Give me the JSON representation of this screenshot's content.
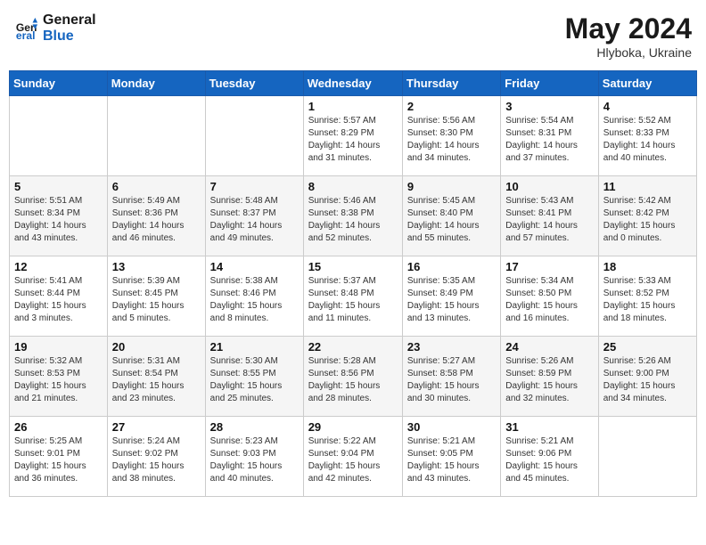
{
  "header": {
    "logo_line1": "General",
    "logo_line2": "Blue",
    "month_year": "May 2024",
    "location": "Hlyboka, Ukraine"
  },
  "weekdays": [
    "Sunday",
    "Monday",
    "Tuesday",
    "Wednesday",
    "Thursday",
    "Friday",
    "Saturday"
  ],
  "weeks": [
    [
      {
        "day": "",
        "info": ""
      },
      {
        "day": "",
        "info": ""
      },
      {
        "day": "",
        "info": ""
      },
      {
        "day": "1",
        "info": "Sunrise: 5:57 AM\nSunset: 8:29 PM\nDaylight: 14 hours\nand 31 minutes."
      },
      {
        "day": "2",
        "info": "Sunrise: 5:56 AM\nSunset: 8:30 PM\nDaylight: 14 hours\nand 34 minutes."
      },
      {
        "day": "3",
        "info": "Sunrise: 5:54 AM\nSunset: 8:31 PM\nDaylight: 14 hours\nand 37 minutes."
      },
      {
        "day": "4",
        "info": "Sunrise: 5:52 AM\nSunset: 8:33 PM\nDaylight: 14 hours\nand 40 minutes."
      }
    ],
    [
      {
        "day": "5",
        "info": "Sunrise: 5:51 AM\nSunset: 8:34 PM\nDaylight: 14 hours\nand 43 minutes."
      },
      {
        "day": "6",
        "info": "Sunrise: 5:49 AM\nSunset: 8:36 PM\nDaylight: 14 hours\nand 46 minutes."
      },
      {
        "day": "7",
        "info": "Sunrise: 5:48 AM\nSunset: 8:37 PM\nDaylight: 14 hours\nand 49 minutes."
      },
      {
        "day": "8",
        "info": "Sunrise: 5:46 AM\nSunset: 8:38 PM\nDaylight: 14 hours\nand 52 minutes."
      },
      {
        "day": "9",
        "info": "Sunrise: 5:45 AM\nSunset: 8:40 PM\nDaylight: 14 hours\nand 55 minutes."
      },
      {
        "day": "10",
        "info": "Sunrise: 5:43 AM\nSunset: 8:41 PM\nDaylight: 14 hours\nand 57 minutes."
      },
      {
        "day": "11",
        "info": "Sunrise: 5:42 AM\nSunset: 8:42 PM\nDaylight: 15 hours\nand 0 minutes."
      }
    ],
    [
      {
        "day": "12",
        "info": "Sunrise: 5:41 AM\nSunset: 8:44 PM\nDaylight: 15 hours\nand 3 minutes."
      },
      {
        "day": "13",
        "info": "Sunrise: 5:39 AM\nSunset: 8:45 PM\nDaylight: 15 hours\nand 5 minutes."
      },
      {
        "day": "14",
        "info": "Sunrise: 5:38 AM\nSunset: 8:46 PM\nDaylight: 15 hours\nand 8 minutes."
      },
      {
        "day": "15",
        "info": "Sunrise: 5:37 AM\nSunset: 8:48 PM\nDaylight: 15 hours\nand 11 minutes."
      },
      {
        "day": "16",
        "info": "Sunrise: 5:35 AM\nSunset: 8:49 PM\nDaylight: 15 hours\nand 13 minutes."
      },
      {
        "day": "17",
        "info": "Sunrise: 5:34 AM\nSunset: 8:50 PM\nDaylight: 15 hours\nand 16 minutes."
      },
      {
        "day": "18",
        "info": "Sunrise: 5:33 AM\nSunset: 8:52 PM\nDaylight: 15 hours\nand 18 minutes."
      }
    ],
    [
      {
        "day": "19",
        "info": "Sunrise: 5:32 AM\nSunset: 8:53 PM\nDaylight: 15 hours\nand 21 minutes."
      },
      {
        "day": "20",
        "info": "Sunrise: 5:31 AM\nSunset: 8:54 PM\nDaylight: 15 hours\nand 23 minutes."
      },
      {
        "day": "21",
        "info": "Sunrise: 5:30 AM\nSunset: 8:55 PM\nDaylight: 15 hours\nand 25 minutes."
      },
      {
        "day": "22",
        "info": "Sunrise: 5:28 AM\nSunset: 8:56 PM\nDaylight: 15 hours\nand 28 minutes."
      },
      {
        "day": "23",
        "info": "Sunrise: 5:27 AM\nSunset: 8:58 PM\nDaylight: 15 hours\nand 30 minutes."
      },
      {
        "day": "24",
        "info": "Sunrise: 5:26 AM\nSunset: 8:59 PM\nDaylight: 15 hours\nand 32 minutes."
      },
      {
        "day": "25",
        "info": "Sunrise: 5:26 AM\nSunset: 9:00 PM\nDaylight: 15 hours\nand 34 minutes."
      }
    ],
    [
      {
        "day": "26",
        "info": "Sunrise: 5:25 AM\nSunset: 9:01 PM\nDaylight: 15 hours\nand 36 minutes."
      },
      {
        "day": "27",
        "info": "Sunrise: 5:24 AM\nSunset: 9:02 PM\nDaylight: 15 hours\nand 38 minutes."
      },
      {
        "day": "28",
        "info": "Sunrise: 5:23 AM\nSunset: 9:03 PM\nDaylight: 15 hours\nand 40 minutes."
      },
      {
        "day": "29",
        "info": "Sunrise: 5:22 AM\nSunset: 9:04 PM\nDaylight: 15 hours\nand 42 minutes."
      },
      {
        "day": "30",
        "info": "Sunrise: 5:21 AM\nSunset: 9:05 PM\nDaylight: 15 hours\nand 43 minutes."
      },
      {
        "day": "31",
        "info": "Sunrise: 5:21 AM\nSunset: 9:06 PM\nDaylight: 15 hours\nand 45 minutes."
      },
      {
        "day": "",
        "info": ""
      }
    ]
  ]
}
